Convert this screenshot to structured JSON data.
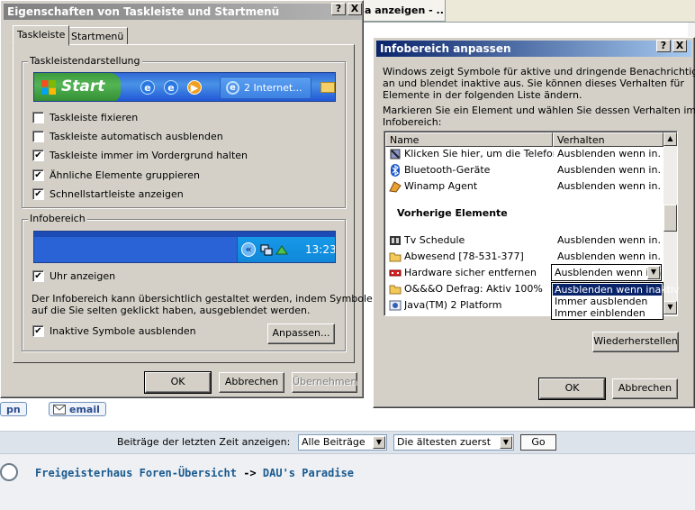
{
  "browser": {
    "tab_title": "a anzeigen - ...",
    "quick_buttons": [
      {
        "label": "pn"
      },
      {
        "label": "email"
      }
    ],
    "posts_filter": {
      "label": "Beiträge der letzten Zeit anzeigen:",
      "period_value": "Alle Beiträge",
      "order_value": "Die ältesten zuerst",
      "go_label": "Go"
    },
    "breadcrumb": {
      "forum": "Freigeisterhaus Foren-Übersicht",
      "separator": "->",
      "section": "DAU's Paradise"
    }
  },
  "taskbar_dialog": {
    "title": "Eigenschaften von Taskleiste und Startmenü",
    "help_glyph": "?",
    "close_glyph": "X",
    "tabs": [
      {
        "label": "Taskleiste",
        "active": true
      },
      {
        "label": "Startmenü",
        "active": false
      }
    ],
    "taskbar_group": {
      "label": "Taskleistendarstellung",
      "preview": {
        "start_label": "Start",
        "task_label": "2 Internet..."
      },
      "options": [
        {
          "label": "Taskleiste fixieren",
          "checked": false
        },
        {
          "label": "Taskleiste automatisch ausblenden",
          "checked": false
        },
        {
          "label": "Taskleiste immer im Vordergrund halten",
          "checked": true
        },
        {
          "label": "Ähnliche Elemente gruppieren",
          "checked": true
        },
        {
          "label": "Schnellstartleiste anzeigen",
          "checked": true
        }
      ]
    },
    "tray_group": {
      "label": "Infobereich",
      "clock": "13:23",
      "show_clock": {
        "label": "Uhr anzeigen",
        "checked": true
      },
      "description_line1": "Der Infobereich kann übersichtlich gestaltet werden, indem Symbole,",
      "description_line2": "auf die Sie selten geklickt haben, ausgeblendet werden.",
      "hide_inactive": {
        "label": "Inaktive Symbole ausblenden",
        "checked": true
      },
      "customize_label": "Anpassen..."
    },
    "buttons": {
      "ok": "OK",
      "cancel": "Abbrechen",
      "apply": "Übernehmen"
    }
  },
  "notify_dialog": {
    "title": "Infobereich anpassen",
    "help_glyph": "?",
    "close_glyph": "X",
    "intro_line1": "Windows zeigt Symbole für aktive und dringende Benachrichtigungen",
    "intro_line2": "an und blendet inaktive aus. Sie können dieses Verhalten für",
    "intro_line3": "Elemente in der folgenden Liste ändern.",
    "instruction_line1": "Markieren Sie ein Element und wählen Sie dessen Verhalten im",
    "instruction_line2": "Infobereich:",
    "columns": {
      "name": "Name",
      "behavior": "Verhalten"
    },
    "current_rows": [
      {
        "name": "Klicken Sie hier, um die Telefon ...",
        "behavior": "Ausblenden wenn in...",
        "icon": "phone-icon"
      },
      {
        "name": "Bluetooth-Geräte",
        "behavior": "Ausblenden wenn in...",
        "icon": "bluetooth-icon"
      },
      {
        "name": "Winamp Agent",
        "behavior": "Ausblenden wenn in...",
        "icon": "winamp-icon"
      }
    ],
    "past_section_label": "Vorherige Elemente",
    "past_rows": [
      {
        "name": "Tv Schedule",
        "behavior": "Ausblenden wenn in...",
        "icon": "film-icon"
      },
      {
        "name": "Abwesend [78-531-377]",
        "behavior": "Ausblenden wenn in...",
        "icon": "folder-icon"
      },
      {
        "name": "Hardware sicher entfernen",
        "behavior": "Ausblenden wenn ina",
        "icon": "hardware-remove-icon"
      },
      {
        "name": "O&&&O Defrag: Aktiv 100%",
        "behavior": "",
        "icon": "folder-icon"
      },
      {
        "name": "Java(TM) 2 Platform",
        "behavior": "",
        "icon": "java-icon"
      }
    ],
    "behavior_dropdown": {
      "value": "Ausblenden wenn ina",
      "options": [
        "Ausblenden wenn inaktiv",
        "Immer ausblenden",
        "Immer einblenden"
      ],
      "selected_index": 0
    },
    "buttons": {
      "restore": "Wiederherstellen",
      "ok": "OK",
      "cancel": "Abbrechen"
    }
  }
}
